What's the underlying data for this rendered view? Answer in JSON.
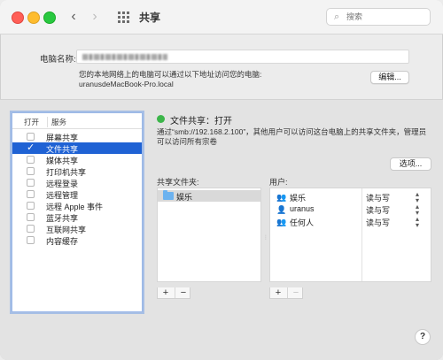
{
  "window": {
    "title": "共享",
    "search_placeholder": "搜索"
  },
  "computer_name": {
    "label": "电脑名称:",
    "info_line1": "您的本地网络上的电脑可以通过以下地址访问您的电脑:",
    "info_line2": "uranusdeMacBook-Pro.local",
    "edit_button": "编辑..."
  },
  "services": {
    "col_on": "打开",
    "col_service": "服务",
    "items": [
      {
        "label": "屏幕共享",
        "checked": false,
        "selected": false
      },
      {
        "label": "文件共享",
        "checked": true,
        "selected": true
      },
      {
        "label": "媒体共享",
        "checked": false,
        "selected": false
      },
      {
        "label": "打印机共享",
        "checked": false,
        "selected": false
      },
      {
        "label": "远程登录",
        "checked": false,
        "selected": false
      },
      {
        "label": "远程管理",
        "checked": false,
        "selected": false
      },
      {
        "label": "远程 Apple 事件",
        "checked": false,
        "selected": false
      },
      {
        "label": "蓝牙共享",
        "checked": false,
        "selected": false
      },
      {
        "label": "互联网共享",
        "checked": false,
        "selected": false
      },
      {
        "label": "内容缓存",
        "checked": false,
        "selected": false
      }
    ]
  },
  "detail": {
    "status": "文件共享：打开",
    "status_color": "#3cb64a",
    "description": "通过“smb://192.168.2.100”，其他用户可以访问这台电脑上的共享文件夹，管理员可以访问所有宗卷",
    "options_button": "选项...",
    "shared_folders_label": "共享文件夹:",
    "users_label": "用户:",
    "shared_folders": [
      "娱乐"
    ],
    "users": [
      {
        "icon": "group-icon",
        "name": "娱乐",
        "permission": "读与写"
      },
      {
        "icon": "user-icon",
        "name": "uranus",
        "permission": "读与写"
      },
      {
        "icon": "group-icon",
        "name": "任何人",
        "permission": "读与写"
      }
    ],
    "plus": "+",
    "minus": "−"
  },
  "help": "?"
}
